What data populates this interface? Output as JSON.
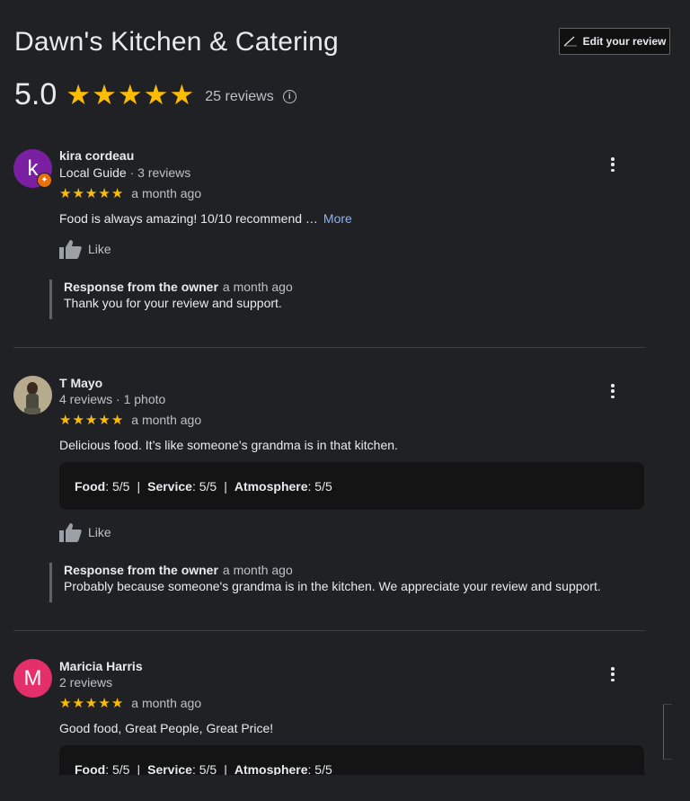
{
  "business": {
    "title": "Dawn's Kitchen & Catering",
    "rating": "5.0",
    "stars": 5,
    "review_count": "25 reviews"
  },
  "edit_button": {
    "label": "Edit your review",
    "icon": "pencil-icon"
  },
  "colors": {
    "background": "#202124",
    "star": "#fbbc04",
    "link": "#8ab4f8",
    "avatar_kira": "#7b1fa2",
    "avatar_maricia": "#e52f6b",
    "guide_badge": "#e8710a"
  },
  "reviews": [
    {
      "name": "kira cordeau",
      "avatar_letter": "k",
      "local_guide": "Local Guide",
      "meta": " · 3 reviews",
      "stars": 5,
      "when": "a month ago",
      "text": "Food is always amazing! 10/10 recommend …",
      "more": "More",
      "like": "Like",
      "owner_label": "Response from the owner",
      "owner_when": "a month ago",
      "owner_text": "Thank you for your review and support."
    },
    {
      "name": "T Mayo",
      "meta": "4 reviews · 1 photo",
      "stars": 5,
      "when": "a month ago",
      "text": "Delicious food. It’s like someone’s grandma is in that kitchen.",
      "attributes": [
        {
          "label": "Food",
          "value": ": 5/5"
        },
        {
          "label": "Service",
          "value": ": 5/5"
        },
        {
          "label": "Atmosphere",
          "value": ": 5/5"
        }
      ],
      "like": "Like",
      "owner_label": "Response from the owner",
      "owner_when": "a month ago",
      "owner_text": "Probably because someone's grandma is in the kitchen. We appreciate your review and support."
    },
    {
      "name": "Maricia Harris",
      "avatar_letter": "M",
      "meta": "2 reviews",
      "stars": 5,
      "when": "a month ago",
      "text": "Good food, Great People, Great Price!",
      "attributes": [
        {
          "label": "Food",
          "value": ": 5/5"
        },
        {
          "label": "Service",
          "value": ": 5/5"
        },
        {
          "label": "Atmosphere",
          "value": ": 5/5"
        }
      ]
    }
  ],
  "separator": "|"
}
